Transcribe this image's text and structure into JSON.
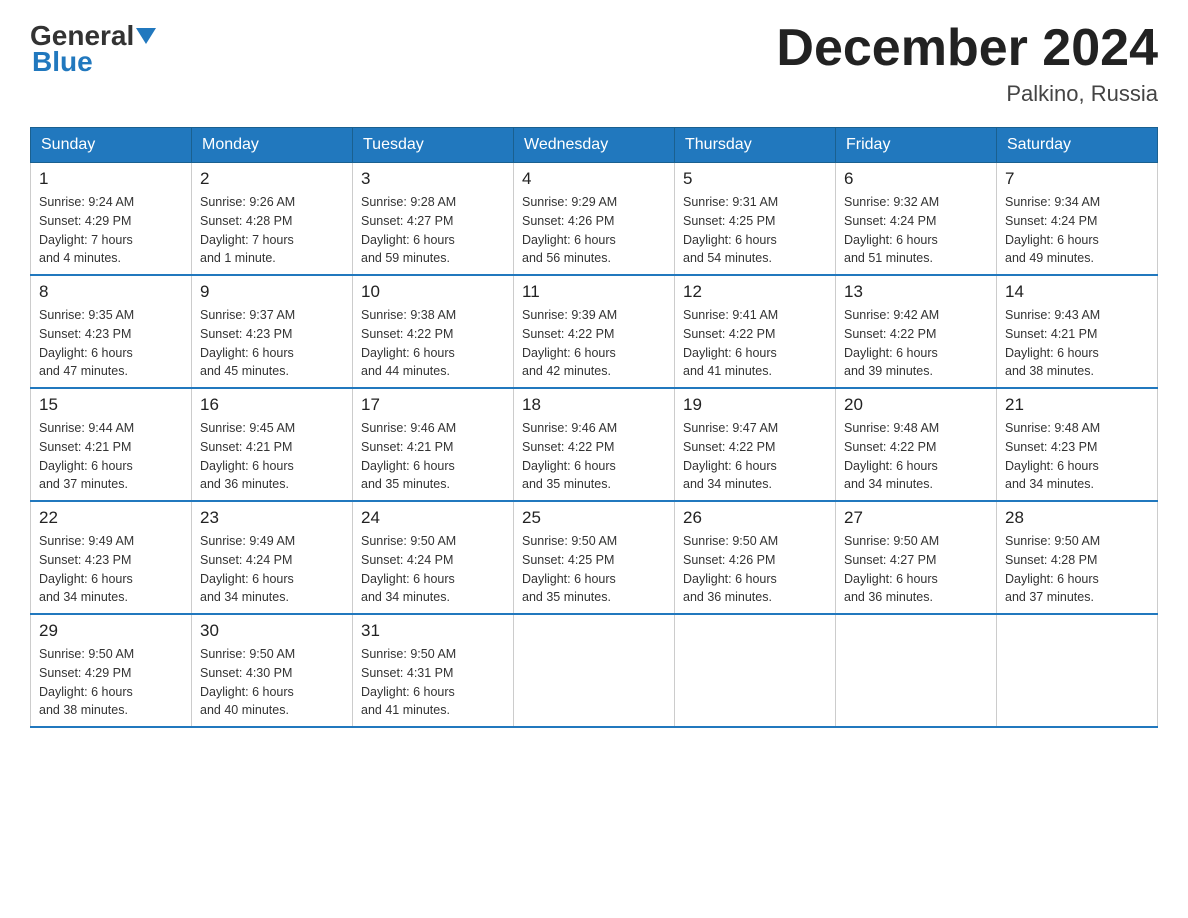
{
  "header": {
    "logo_general": "General",
    "logo_blue": "Blue",
    "month_title": "December 2024",
    "location": "Palkino, Russia"
  },
  "days_of_week": [
    "Sunday",
    "Monday",
    "Tuesday",
    "Wednesday",
    "Thursday",
    "Friday",
    "Saturday"
  ],
  "weeks": [
    [
      {
        "day": "1",
        "sunrise": "9:24 AM",
        "sunset": "4:29 PM",
        "daylight": "7 hours and 4 minutes."
      },
      {
        "day": "2",
        "sunrise": "9:26 AM",
        "sunset": "4:28 PM",
        "daylight": "7 hours and 1 minute."
      },
      {
        "day": "3",
        "sunrise": "9:28 AM",
        "sunset": "4:27 PM",
        "daylight": "6 hours and 59 minutes."
      },
      {
        "day": "4",
        "sunrise": "9:29 AM",
        "sunset": "4:26 PM",
        "daylight": "6 hours and 56 minutes."
      },
      {
        "day": "5",
        "sunrise": "9:31 AM",
        "sunset": "4:25 PM",
        "daylight": "6 hours and 54 minutes."
      },
      {
        "day": "6",
        "sunrise": "9:32 AM",
        "sunset": "4:24 PM",
        "daylight": "6 hours and 51 minutes."
      },
      {
        "day": "7",
        "sunrise": "9:34 AM",
        "sunset": "4:24 PM",
        "daylight": "6 hours and 49 minutes."
      }
    ],
    [
      {
        "day": "8",
        "sunrise": "9:35 AM",
        "sunset": "4:23 PM",
        "daylight": "6 hours and 47 minutes."
      },
      {
        "day": "9",
        "sunrise": "9:37 AM",
        "sunset": "4:23 PM",
        "daylight": "6 hours and 45 minutes."
      },
      {
        "day": "10",
        "sunrise": "9:38 AM",
        "sunset": "4:22 PM",
        "daylight": "6 hours and 44 minutes."
      },
      {
        "day": "11",
        "sunrise": "9:39 AM",
        "sunset": "4:22 PM",
        "daylight": "6 hours and 42 minutes."
      },
      {
        "day": "12",
        "sunrise": "9:41 AM",
        "sunset": "4:22 PM",
        "daylight": "6 hours and 41 minutes."
      },
      {
        "day": "13",
        "sunrise": "9:42 AM",
        "sunset": "4:22 PM",
        "daylight": "6 hours and 39 minutes."
      },
      {
        "day": "14",
        "sunrise": "9:43 AM",
        "sunset": "4:21 PM",
        "daylight": "6 hours and 38 minutes."
      }
    ],
    [
      {
        "day": "15",
        "sunrise": "9:44 AM",
        "sunset": "4:21 PM",
        "daylight": "6 hours and 37 minutes."
      },
      {
        "day": "16",
        "sunrise": "9:45 AM",
        "sunset": "4:21 PM",
        "daylight": "6 hours and 36 minutes."
      },
      {
        "day": "17",
        "sunrise": "9:46 AM",
        "sunset": "4:21 PM",
        "daylight": "6 hours and 35 minutes."
      },
      {
        "day": "18",
        "sunrise": "9:46 AM",
        "sunset": "4:22 PM",
        "daylight": "6 hours and 35 minutes."
      },
      {
        "day": "19",
        "sunrise": "9:47 AM",
        "sunset": "4:22 PM",
        "daylight": "6 hours and 34 minutes."
      },
      {
        "day": "20",
        "sunrise": "9:48 AM",
        "sunset": "4:22 PM",
        "daylight": "6 hours and 34 minutes."
      },
      {
        "day": "21",
        "sunrise": "9:48 AM",
        "sunset": "4:23 PM",
        "daylight": "6 hours and 34 minutes."
      }
    ],
    [
      {
        "day": "22",
        "sunrise": "9:49 AM",
        "sunset": "4:23 PM",
        "daylight": "6 hours and 34 minutes."
      },
      {
        "day": "23",
        "sunrise": "9:49 AM",
        "sunset": "4:24 PM",
        "daylight": "6 hours and 34 minutes."
      },
      {
        "day": "24",
        "sunrise": "9:50 AM",
        "sunset": "4:24 PM",
        "daylight": "6 hours and 34 minutes."
      },
      {
        "day": "25",
        "sunrise": "9:50 AM",
        "sunset": "4:25 PM",
        "daylight": "6 hours and 35 minutes."
      },
      {
        "day": "26",
        "sunrise": "9:50 AM",
        "sunset": "4:26 PM",
        "daylight": "6 hours and 36 minutes."
      },
      {
        "day": "27",
        "sunrise": "9:50 AM",
        "sunset": "4:27 PM",
        "daylight": "6 hours and 36 minutes."
      },
      {
        "day": "28",
        "sunrise": "9:50 AM",
        "sunset": "4:28 PM",
        "daylight": "6 hours and 37 minutes."
      }
    ],
    [
      {
        "day": "29",
        "sunrise": "9:50 AM",
        "sunset": "4:29 PM",
        "daylight": "6 hours and 38 minutes."
      },
      {
        "day": "30",
        "sunrise": "9:50 AM",
        "sunset": "4:30 PM",
        "daylight": "6 hours and 40 minutes."
      },
      {
        "day": "31",
        "sunrise": "9:50 AM",
        "sunset": "4:31 PM",
        "daylight": "6 hours and 41 minutes."
      },
      null,
      null,
      null,
      null
    ]
  ],
  "labels": {
    "sunrise": "Sunrise:",
    "sunset": "Sunset:",
    "daylight": "Daylight:"
  }
}
